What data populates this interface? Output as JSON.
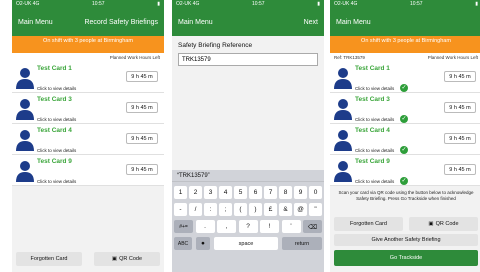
{
  "status": {
    "carrier": "O2-UK 4G",
    "time": "10:57"
  },
  "screen1": {
    "nav_left": "Main Menu",
    "nav_right": "Record Safety Briefings",
    "shift": "On shift with 3 people at Birmingham",
    "planned_hdr": "Planned Work Hours Left",
    "cards": [
      {
        "title": "Test Card 1",
        "sub": "Click to view details",
        "hours": "9 h 45 m"
      },
      {
        "title": "Test Card 3",
        "sub": "Click to view details",
        "hours": "9 h 45 m"
      },
      {
        "title": "Test Card 4",
        "sub": "Click to view details",
        "hours": "9 h 45 m"
      },
      {
        "title": "Test Card 9",
        "sub": "Click to view details",
        "hours": "9 h 45 m"
      }
    ],
    "forgotten": "Forgotten Card",
    "qr": "QR Code"
  },
  "screen2": {
    "nav_left": "Main Menu",
    "nav_right": "Next",
    "field_label": "Safety Briefing Reference",
    "field_value": "TRK13579",
    "suggestion": "“TRK13579”",
    "row1": [
      "1",
      "2",
      "3",
      "4",
      "5",
      "6",
      "7",
      "8",
      "9",
      "0"
    ],
    "row2": [
      "-",
      "/",
      ":",
      ";",
      "(",
      ")",
      "£",
      "&",
      "@",
      "\""
    ],
    "row3": [
      "#+=",
      ".",
      ",",
      "?",
      "!",
      "'",
      "⌫"
    ],
    "row4": [
      "ABC",
      "space",
      "return"
    ]
  },
  "screen3": {
    "nav_left": "Main Menu",
    "shift": "On shift with 3 people at Birmingham",
    "ref": "Ref: TRK13579",
    "planned_hdr": "Planned Work Hours Left",
    "cards": [
      {
        "title": "Test Card 1",
        "sub": "Click to view details",
        "hours": "9 h 45 m"
      },
      {
        "title": "Test Card 3",
        "sub": "Click to view details",
        "hours": "9 h 45 m"
      },
      {
        "title": "Test Card 4",
        "sub": "Click to view details",
        "hours": "9 h 45 m"
      },
      {
        "title": "Test Card 9",
        "sub": "Click to view details",
        "hours": "9 h 45 m"
      }
    ],
    "instructions": "Scan your card via QR code using the button below to acknowledge Safety Briefing. Press Go Trackside when finished",
    "forgotten": "Forgotten Card",
    "qr": "QR Code",
    "another": "Give Another Safety Briefing",
    "go": "Go Trackside"
  },
  "colors": {
    "header": "#2e8b3a",
    "shift": "#f7931e",
    "title": "#3aa53a"
  }
}
